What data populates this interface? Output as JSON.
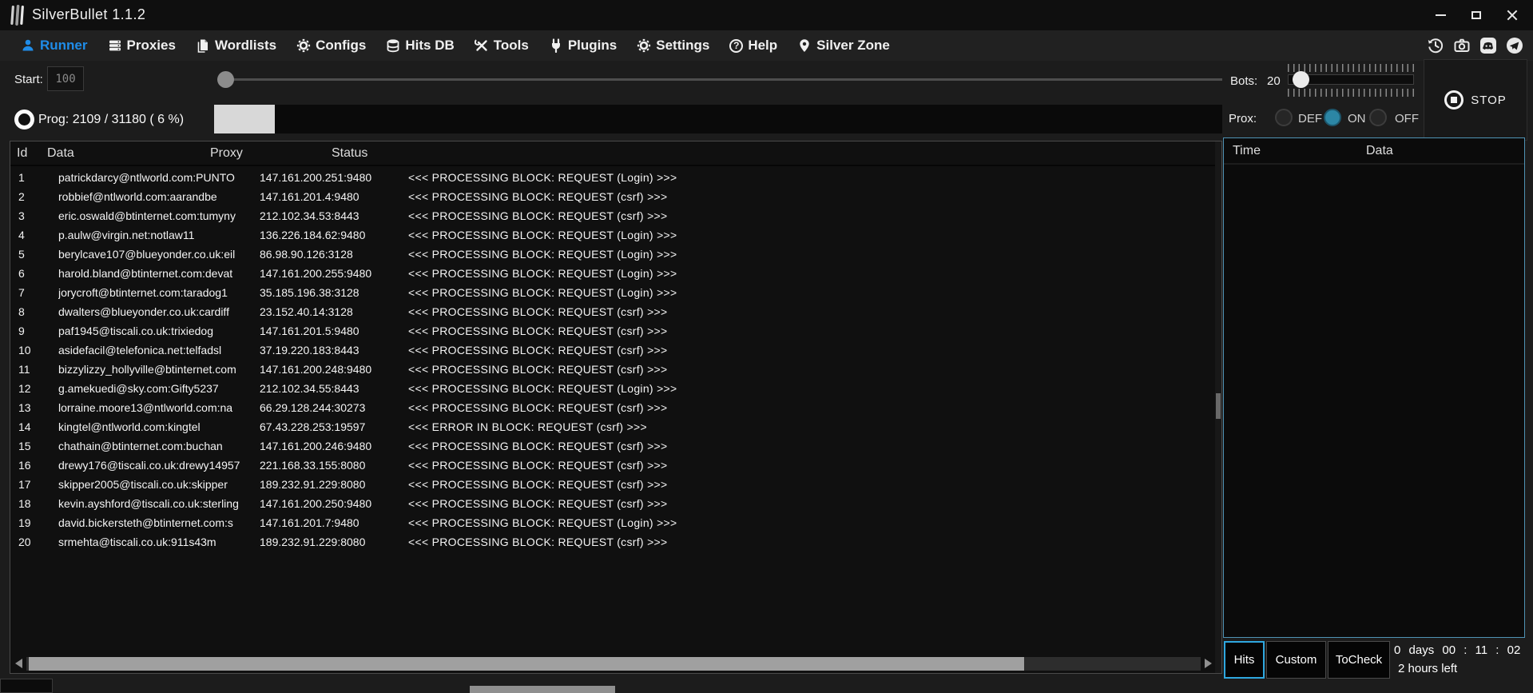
{
  "titlebar": {
    "app_title": "SilverBullet 1.1.2"
  },
  "menubar": {
    "items": [
      {
        "label": "Runner",
        "icon": "runner-person-icon",
        "active": true
      },
      {
        "label": "Proxies",
        "icon": "server-stack-icon",
        "active": false
      },
      {
        "label": "Wordlists",
        "icon": "document-icon",
        "active": false
      },
      {
        "label": "Configs",
        "icon": "gear-icon",
        "active": false
      },
      {
        "label": "Hits DB",
        "icon": "database-icon",
        "active": false
      },
      {
        "label": "Tools",
        "icon": "crossed-tools-icon",
        "active": false
      },
      {
        "label": "Plugins",
        "icon": "plug-icon",
        "active": false
      },
      {
        "label": "Settings",
        "icon": "gear-icon",
        "active": false
      },
      {
        "label": "Help",
        "icon": "question-circle-icon",
        "active": false
      },
      {
        "label": "Silver Zone",
        "icon": "location-pin-icon",
        "active": false
      }
    ],
    "right_icons": [
      "history-icon",
      "camera-icon",
      "discord-icon",
      "telegram-icon"
    ]
  },
  "controls": {
    "start_label": "Start:",
    "start_value": "100",
    "bots_label": "Bots:",
    "bots_value": "20",
    "stop_label": "STOP",
    "prog_label": "Prog:",
    "prog_value": "2109  /  31180  ( 6 %)",
    "progress_percent": 6,
    "prox_label": "Prox:",
    "prox_options": [
      {
        "label": "DEF",
        "selected": false
      },
      {
        "label": "ON",
        "selected": true
      },
      {
        "label": "OFF",
        "selected": false
      }
    ]
  },
  "table": {
    "headers": [
      "Id",
      "Data",
      "Proxy",
      "Status"
    ],
    "rows": [
      {
        "id": "1",
        "data": "patrickdarcy@ntlworld.com:PUNTO",
        "proxy": "147.161.200.251:9480",
        "status": "<<< PROCESSING BLOCK: REQUEST (Login) >>>"
      },
      {
        "id": "2",
        "data": "robbief@ntlworld.com:aarandbe",
        "proxy": "147.161.201.4:9480",
        "status": "<<< PROCESSING BLOCK: REQUEST (csrf) >>>"
      },
      {
        "id": "3",
        "data": "eric.oswald@btinternet.com:tumyny",
        "proxy": "212.102.34.53:8443",
        "status": "<<< PROCESSING BLOCK: REQUEST (csrf) >>>"
      },
      {
        "id": "4",
        "data": "p.aulw@virgin.net:notlaw11",
        "proxy": "136.226.184.62:9480",
        "status": "<<< PROCESSING BLOCK: REQUEST (Login) >>>"
      },
      {
        "id": "5",
        "data": "berylcave107@blueyonder.co.uk:eil",
        "proxy": "86.98.90.126:3128",
        "status": "<<< PROCESSING BLOCK: REQUEST (Login) >>>"
      },
      {
        "id": "6",
        "data": "harold.bland@btinternet.com:devat",
        "proxy": "147.161.200.255:9480",
        "status": "<<< PROCESSING BLOCK: REQUEST (Login) >>>"
      },
      {
        "id": "7",
        "data": "jorycroft@btinternet.com:taradog1",
        "proxy": "35.185.196.38:3128",
        "status": "<<< PROCESSING BLOCK: REQUEST (Login) >>>"
      },
      {
        "id": "8",
        "data": "dwalters@blueyonder.co.uk:cardiff",
        "proxy": "23.152.40.14:3128",
        "status": "<<< PROCESSING BLOCK: REQUEST (csrf) >>>"
      },
      {
        "id": "9",
        "data": "paf1945@tiscali.co.uk:trixiedog",
        "proxy": "147.161.201.5:9480",
        "status": "<<< PROCESSING BLOCK: REQUEST (csrf) >>>"
      },
      {
        "id": "10",
        "data": "asidefacil@telefonica.net:telfadsl",
        "proxy": "37.19.220.183:8443",
        "status": "<<< PROCESSING BLOCK: REQUEST (csrf) >>>"
      },
      {
        "id": "11",
        "data": "bizzylizzy_hollyville@btinternet.com",
        "proxy": "147.161.200.248:9480",
        "status": "<<< PROCESSING BLOCK: REQUEST (csrf) >>>"
      },
      {
        "id": "12",
        "data": "g.amekuedi@sky.com:Gifty5237",
        "proxy": "212.102.34.55:8443",
        "status": "<<< PROCESSING BLOCK: REQUEST (Login) >>>"
      },
      {
        "id": "13",
        "data": "lorraine.moore13@ntlworld.com:na",
        "proxy": "66.29.128.244:30273",
        "status": "<<< PROCESSING BLOCK: REQUEST (csrf) >>>"
      },
      {
        "id": "14",
        "data": "kingtel@ntlworld.com:kingtel",
        "proxy": "67.43.228.253:19597",
        "status": "<<< ERROR IN BLOCK: REQUEST (csrf) >>>"
      },
      {
        "id": "15",
        "data": "chathain@btinternet.com:buchan",
        "proxy": "147.161.200.246:9480",
        "status": "<<< PROCESSING BLOCK: REQUEST (csrf) >>>"
      },
      {
        "id": "16",
        "data": "drewy176@tiscali.co.uk:drewy14957",
        "proxy": "221.168.33.155:8080",
        "status": "<<< PROCESSING BLOCK: REQUEST (csrf) >>>"
      },
      {
        "id": "17",
        "data": "skipper2005@tiscali.co.uk:skipper",
        "proxy": "189.232.91.229:8080",
        "status": "<<< PROCESSING BLOCK: REQUEST (csrf) >>>"
      },
      {
        "id": "18",
        "data": "kevin.ayshford@tiscali.co.uk:sterling",
        "proxy": "147.161.200.250:9480",
        "status": "<<< PROCESSING BLOCK: REQUEST (csrf) >>>"
      },
      {
        "id": "19",
        "data": "david.bickersteth@btinternet.com:s",
        "proxy": "147.161.201.7:9480",
        "status": "<<< PROCESSING BLOCK: REQUEST (Login) >>>"
      },
      {
        "id": "20",
        "data": "srmehta@tiscali.co.uk:911s43m",
        "proxy": "189.232.91.229:8080",
        "status": "<<< PROCESSING BLOCK: REQUEST (csrf) >>>"
      }
    ]
  },
  "right_panel": {
    "headers": [
      "Time",
      "Data"
    ],
    "rows": [],
    "tabs": [
      {
        "label": "Hits",
        "active": true
      },
      {
        "label": "Custom",
        "active": false
      },
      {
        "label": "ToCheck",
        "active": false
      }
    ],
    "timer_line1": "0 days 00 : 11 : 02",
    "timer_line2": "2 hours left"
  },
  "colors": {
    "accent_blue": "#1f8ce8",
    "panel_border_blue": "#4f93b5",
    "active_tab_border": "#2fa8e0",
    "radio_on_teal": "#2c86a5",
    "progress_fill": "#d8d8d8"
  }
}
